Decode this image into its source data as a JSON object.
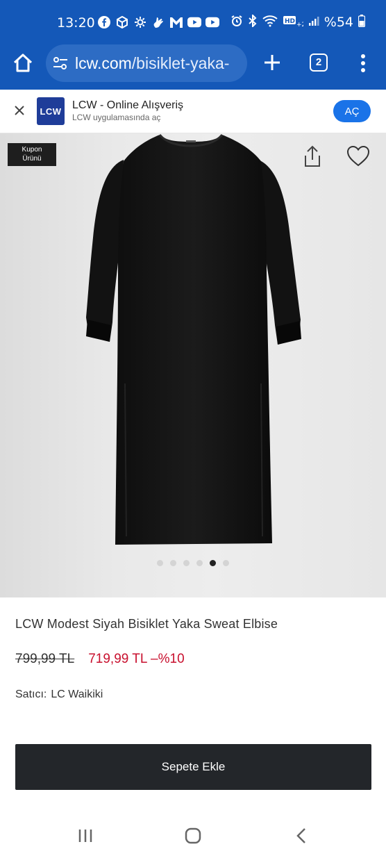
{
  "status_bar": {
    "time": "13:20",
    "battery": "%54",
    "left_icons": [
      "facebook-icon",
      "box-icon",
      "settings-badge-icon",
      "hand-icon",
      "gmail-icon",
      "youtube-icon",
      "youtube-icon"
    ],
    "right_icons": [
      "alarm-icon",
      "bluetooth-icon",
      "wifi-icon",
      "hd-signal-icon",
      "signal-icon",
      "battery-icon"
    ]
  },
  "browser": {
    "url_host": "lcw.com",
    "url_path": "/bisiklet-yaka-",
    "tab_count": "2"
  },
  "app_banner": {
    "logo_text": "LCW",
    "title": "LCW - Online Alışveriş",
    "subtitle": "LCW uygulamasında aç",
    "open_label": "AÇ"
  },
  "gallery": {
    "badge": "Kupon Ürünü",
    "image_count": 6,
    "active_index": 4
  },
  "product": {
    "title": "LCW Modest Siyah Bisiklet Yaka Sweat Elbise",
    "old_price": "799,99 TL",
    "new_price": "719,99 TL",
    "discount": "–%10",
    "seller_label": "Satıcı:",
    "seller_name": "LC Waikiki",
    "add_to_cart": "Sepete Ekle"
  },
  "colors": {
    "browser_blue": "#1458b8",
    "price_red": "#c8102e",
    "button_dark": "#23262a",
    "open_button_blue": "#1a73e8"
  }
}
